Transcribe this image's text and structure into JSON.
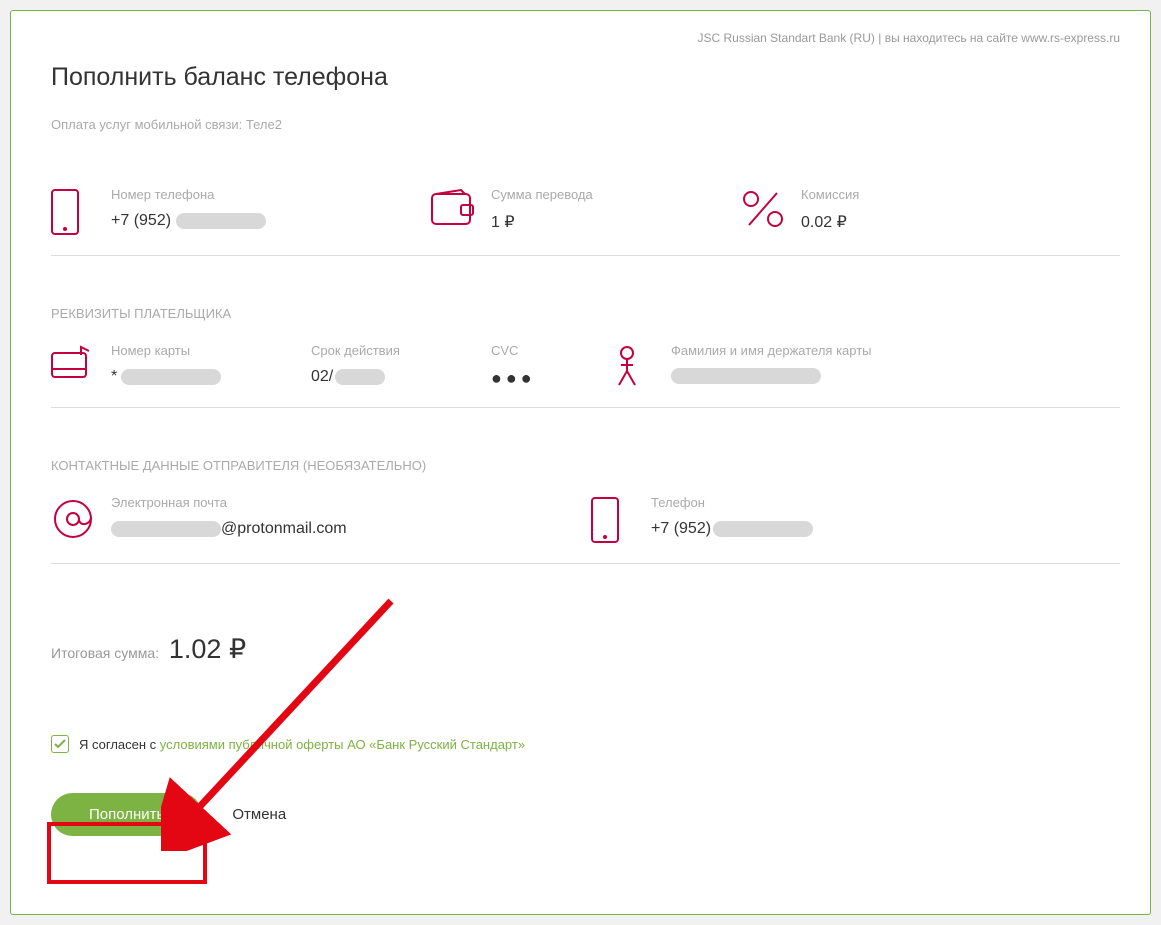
{
  "header": {
    "bank": "JSC Russian Standart Bank (RU)",
    "site_note": "вы находитесь на сайте www.rs-express.ru"
  },
  "page_title": "Пополнить баланс телефона",
  "subtitle": "Оплата услуг мобильной связи: Теле2",
  "transfer": {
    "phone_label": "Номер телефона",
    "phone_prefix": "+7 (952)",
    "amount_label": "Сумма перевода",
    "amount_value": "1 ₽",
    "fee_label": "Комиссия",
    "fee_value": "0.02 ₽"
  },
  "payer_section": "РЕКВИЗИТЫ ПЛАТЕЛЬЩИКА",
  "payer": {
    "card_label": "Номер карты",
    "card_prefix": "*",
    "exp_label": "Срок действия",
    "exp_prefix": "02/",
    "cvc_label": "CVC",
    "cvc_value": "●●●",
    "holder_label": "Фамилия и имя держателя карты"
  },
  "contact_section": "КОНТАКТНЫЕ ДАННЫЕ ОТПРАВИТЕЛЯ (НЕОБЯЗАТЕЛЬНО)",
  "contact": {
    "email_label": "Электронная почта",
    "email_suffix": "@protonmail.com",
    "phone_label": "Телефон",
    "phone_prefix": "+7 (952)"
  },
  "total": {
    "label": "Итоговая сумма:",
    "value": "1.02 ₽"
  },
  "agreement": {
    "prefix": "Я согласен с ",
    "link": "условиями публичной оферты АО «Банк Русский Стандарт»"
  },
  "actions": {
    "submit": "Пополнить",
    "cancel": "Отмена"
  }
}
